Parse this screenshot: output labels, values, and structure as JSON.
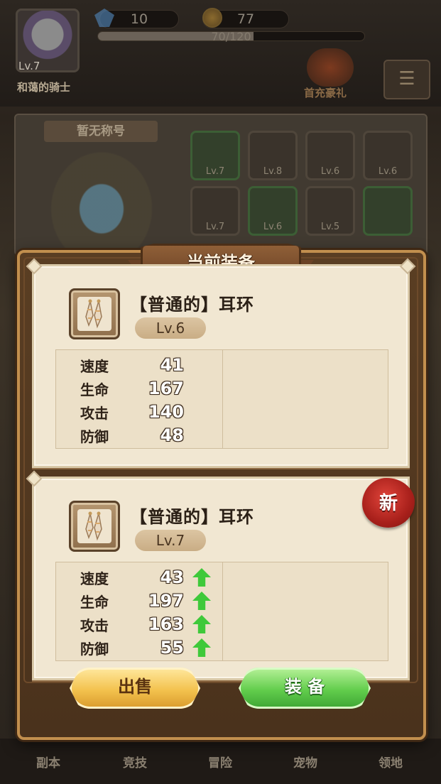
{
  "player": {
    "level_label": "Lv.7",
    "name": "和蔼的骑士",
    "gems": "10",
    "coins": "77",
    "exp_text": "70/120",
    "exp_fraction": 0.583
  },
  "top_menu": {
    "gift_label": "首充豪礼",
    "menu_glyph": "☰"
  },
  "hero": {
    "title": "暂无称号"
  },
  "equipment_slots": [
    {
      "level": "Lv.7",
      "quality": "green"
    },
    {
      "level": "Lv.8",
      "quality": "normal"
    },
    {
      "level": "Lv.6",
      "quality": "normal"
    },
    {
      "level": "Lv.6",
      "quality": "normal"
    },
    {
      "level": "Lv.7",
      "quality": "normal"
    },
    {
      "level": "Lv.6",
      "quality": "green"
    },
    {
      "level": "Lv.5",
      "quality": "normal"
    },
    {
      "level": "",
      "quality": "green"
    }
  ],
  "modal": {
    "title": "当前装备",
    "current": {
      "name": "【普通的】耳环",
      "level": "Lv.6",
      "stats": [
        {
          "label": "速度",
          "value": "41"
        },
        {
          "label": "生命",
          "value": "167"
        },
        {
          "label": "攻击",
          "value": "140"
        },
        {
          "label": "防御",
          "value": "48"
        }
      ]
    },
    "new_item": {
      "badge": "新",
      "name": "【普通的】耳环",
      "level": "Lv.7",
      "stats": [
        {
          "label": "速度",
          "value": "43",
          "trend": "up"
        },
        {
          "label": "生命",
          "value": "197",
          "trend": "up"
        },
        {
          "label": "攻击",
          "value": "163",
          "trend": "up"
        },
        {
          "label": "防御",
          "value": "55",
          "trend": "up"
        }
      ]
    },
    "sell_label": "出售",
    "equip_label": "装 备"
  },
  "bottom_nav": [
    "副本",
    "竞技",
    "冒险",
    "宠物",
    "领地"
  ],
  "colors": {
    "arrow_up": "#3fc93a",
    "seal_red": "#c42a22",
    "sell_gold": "#f3c24e",
    "equip_green": "#62cd4c"
  }
}
